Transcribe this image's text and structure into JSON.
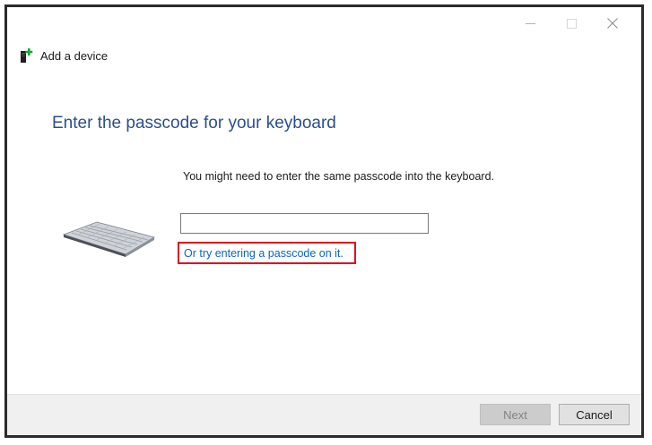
{
  "window": {
    "controls": {
      "minimize_icon": "minimize-icon",
      "maximize_icon": "maximize-icon",
      "close_glyph": "✕"
    }
  },
  "header": {
    "icon": "add-device-icon",
    "title": "Add a device"
  },
  "main": {
    "heading": "Enter the passcode for your keyboard",
    "instruction": "You might need to enter the same passcode into the keyboard.",
    "passcode_input": {
      "value": "",
      "placeholder": ""
    },
    "alt_link": "Or try entering a passcode on it.",
    "device_image": "keyboard-image"
  },
  "footer": {
    "next_label": "Next",
    "cancel_label": "Cancel"
  },
  "colors": {
    "heading": "#2a4f8f",
    "link": "#0a64c8",
    "highlight_border": "#e0101c",
    "footer_bg": "#f0f0f0"
  }
}
